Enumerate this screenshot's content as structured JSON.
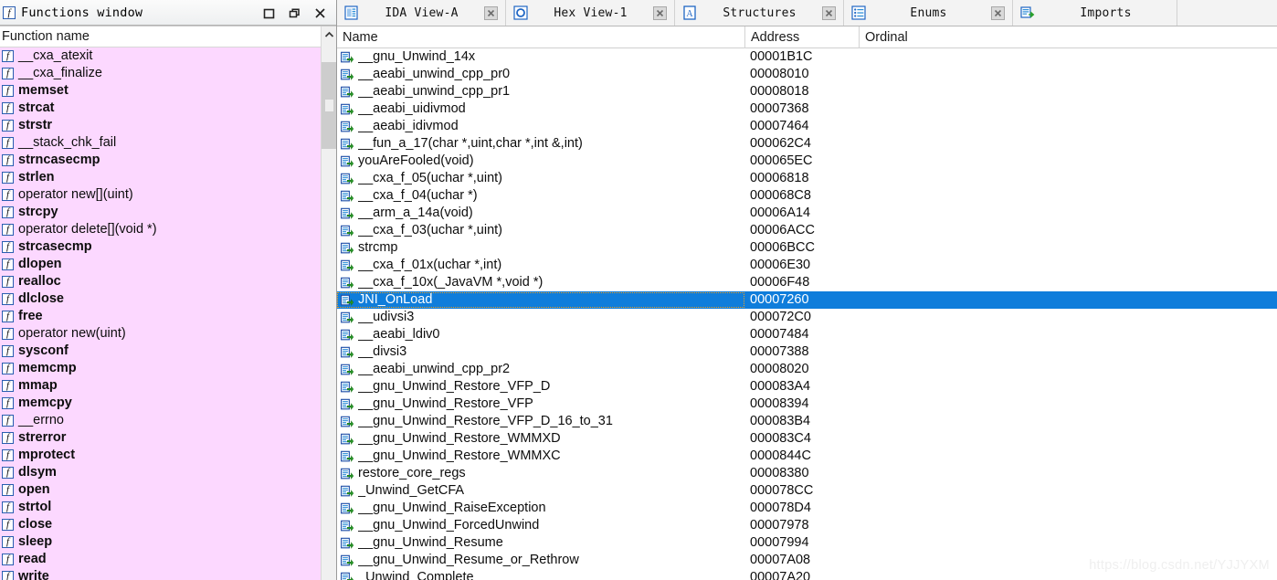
{
  "functions_window": {
    "title": "Functions window",
    "title_icon": "function-f-icon",
    "window_buttons": [
      {
        "name": "maximize-button",
        "glyph": "square"
      },
      {
        "name": "restore-button",
        "glyph": "restore"
      },
      {
        "name": "close-button",
        "glyph": "x"
      }
    ],
    "column_header": "Function name",
    "row_icon_glyph": "f",
    "background_color": "#fcd8ff",
    "functions": [
      {
        "name": "__cxa_atexit",
        "bold": false
      },
      {
        "name": "__cxa_finalize",
        "bold": false
      },
      {
        "name": "memset",
        "bold": true
      },
      {
        "name": "strcat",
        "bold": true
      },
      {
        "name": "strstr",
        "bold": true
      },
      {
        "name": "__stack_chk_fail",
        "bold": false
      },
      {
        "name": "strncasecmp",
        "bold": true
      },
      {
        "name": "strlen",
        "bold": true
      },
      {
        "name": "operator new[](uint)",
        "bold": false
      },
      {
        "name": "strcpy",
        "bold": true
      },
      {
        "name": "operator delete[](void *)",
        "bold": false
      },
      {
        "name": "strcasecmp",
        "bold": true
      },
      {
        "name": "dlopen",
        "bold": true
      },
      {
        "name": "realloc",
        "bold": true
      },
      {
        "name": "dlclose",
        "bold": true
      },
      {
        "name": "free",
        "bold": true
      },
      {
        "name": "operator new(uint)",
        "bold": false
      },
      {
        "name": "sysconf",
        "bold": true
      },
      {
        "name": "memcmp",
        "bold": true
      },
      {
        "name": "mmap",
        "bold": true
      },
      {
        "name": "memcpy",
        "bold": true
      },
      {
        "name": "__errno",
        "bold": false
      },
      {
        "name": "strerror",
        "bold": true
      },
      {
        "name": "mprotect",
        "bold": true
      },
      {
        "name": "dlsym",
        "bold": true
      },
      {
        "name": "open",
        "bold": true
      },
      {
        "name": "strtol",
        "bold": true
      },
      {
        "name": "close",
        "bold": true
      },
      {
        "name": "sleep",
        "bold": true
      },
      {
        "name": "read",
        "bold": true
      },
      {
        "name": "write",
        "bold": true
      }
    ],
    "scrollbar": {
      "up_arrow": "chevron-up-icon"
    }
  },
  "tabs": [
    {
      "label": "IDA View-A",
      "icon": "ida-view-icon",
      "closable": true,
      "active": false
    },
    {
      "label": "Hex View-1",
      "icon": "hex-view-icon",
      "closable": true,
      "active": false
    },
    {
      "label": "Structures",
      "icon": "structures-icon",
      "closable": true,
      "active": false
    },
    {
      "label": "Enums",
      "icon": "enums-icon",
      "closable": true,
      "active": false
    },
    {
      "label": "Imports",
      "icon": "imports-icon",
      "closable": false,
      "active": true
    }
  ],
  "grid": {
    "columns": [
      "Name",
      "Address",
      "Ordinal"
    ],
    "row_icon": "import-entry-icon",
    "selection_color": "#0f7ddb",
    "selected_index": 14,
    "rows": [
      {
        "name": "__gnu_Unwind_14x",
        "address": "00001B1C",
        "ordinal": ""
      },
      {
        "name": "__aeabi_unwind_cpp_pr0",
        "address": "00008010",
        "ordinal": ""
      },
      {
        "name": "__aeabi_unwind_cpp_pr1",
        "address": "00008018",
        "ordinal": ""
      },
      {
        "name": "__aeabi_uidivmod",
        "address": "00007368",
        "ordinal": ""
      },
      {
        "name": "__aeabi_idivmod",
        "address": "00007464",
        "ordinal": ""
      },
      {
        "name": "__fun_a_17(char *,uint,char *,int &,int)",
        "address": "000062C4",
        "ordinal": ""
      },
      {
        "name": "youAreFooled(void)",
        "address": "000065EC",
        "ordinal": ""
      },
      {
        "name": "__cxa_f_05(uchar *,uint)",
        "address": "00006818",
        "ordinal": ""
      },
      {
        "name": "__cxa_f_04(uchar *)",
        "address": "000068C8",
        "ordinal": ""
      },
      {
        "name": "__arm_a_14a(void)",
        "address": "00006A14",
        "ordinal": ""
      },
      {
        "name": "__cxa_f_03(uchar *,uint)",
        "address": "00006ACC",
        "ordinal": ""
      },
      {
        "name": "strcmp",
        "address": "00006BCC",
        "ordinal": ""
      },
      {
        "name": "__cxa_f_01x(uchar *,int)",
        "address": "00006E30",
        "ordinal": ""
      },
      {
        "name": "__cxa_f_10x(_JavaVM *,void *)",
        "address": "00006F48",
        "ordinal": ""
      },
      {
        "name": "JNI_OnLoad",
        "address": "00007260",
        "ordinal": ""
      },
      {
        "name": "__udivsi3",
        "address": "000072C0",
        "ordinal": ""
      },
      {
        "name": "__aeabi_ldiv0",
        "address": "00007484",
        "ordinal": ""
      },
      {
        "name": "__divsi3",
        "address": "00007388",
        "ordinal": ""
      },
      {
        "name": "__aeabi_unwind_cpp_pr2",
        "address": "00008020",
        "ordinal": ""
      },
      {
        "name": "__gnu_Unwind_Restore_VFP_D",
        "address": "000083A4",
        "ordinal": ""
      },
      {
        "name": "__gnu_Unwind_Restore_VFP",
        "address": "00008394",
        "ordinal": ""
      },
      {
        "name": "__gnu_Unwind_Restore_VFP_D_16_to_31",
        "address": "000083B4",
        "ordinal": ""
      },
      {
        "name": "__gnu_Unwind_Restore_WMMXD",
        "address": "000083C4",
        "ordinal": ""
      },
      {
        "name": "__gnu_Unwind_Restore_WMMXC",
        "address": "0000844C",
        "ordinal": ""
      },
      {
        "name": "restore_core_regs",
        "address": "00008380",
        "ordinal": ""
      },
      {
        "name": "_Unwind_GetCFA",
        "address": "000078CC",
        "ordinal": ""
      },
      {
        "name": "__gnu_Unwind_RaiseException",
        "address": "000078D4",
        "ordinal": ""
      },
      {
        "name": "__gnu_Unwind_ForcedUnwind",
        "address": "00007978",
        "ordinal": ""
      },
      {
        "name": "__gnu_Unwind_Resume",
        "address": "00007994",
        "ordinal": ""
      },
      {
        "name": "__gnu_Unwind_Resume_or_Rethrow",
        "address": "00007A08",
        "ordinal": ""
      },
      {
        "name": "_Unwind_Complete",
        "address": "00007A20",
        "ordinal": ""
      }
    ]
  },
  "watermark": "https://blog.csdn.net/YJJYXM"
}
